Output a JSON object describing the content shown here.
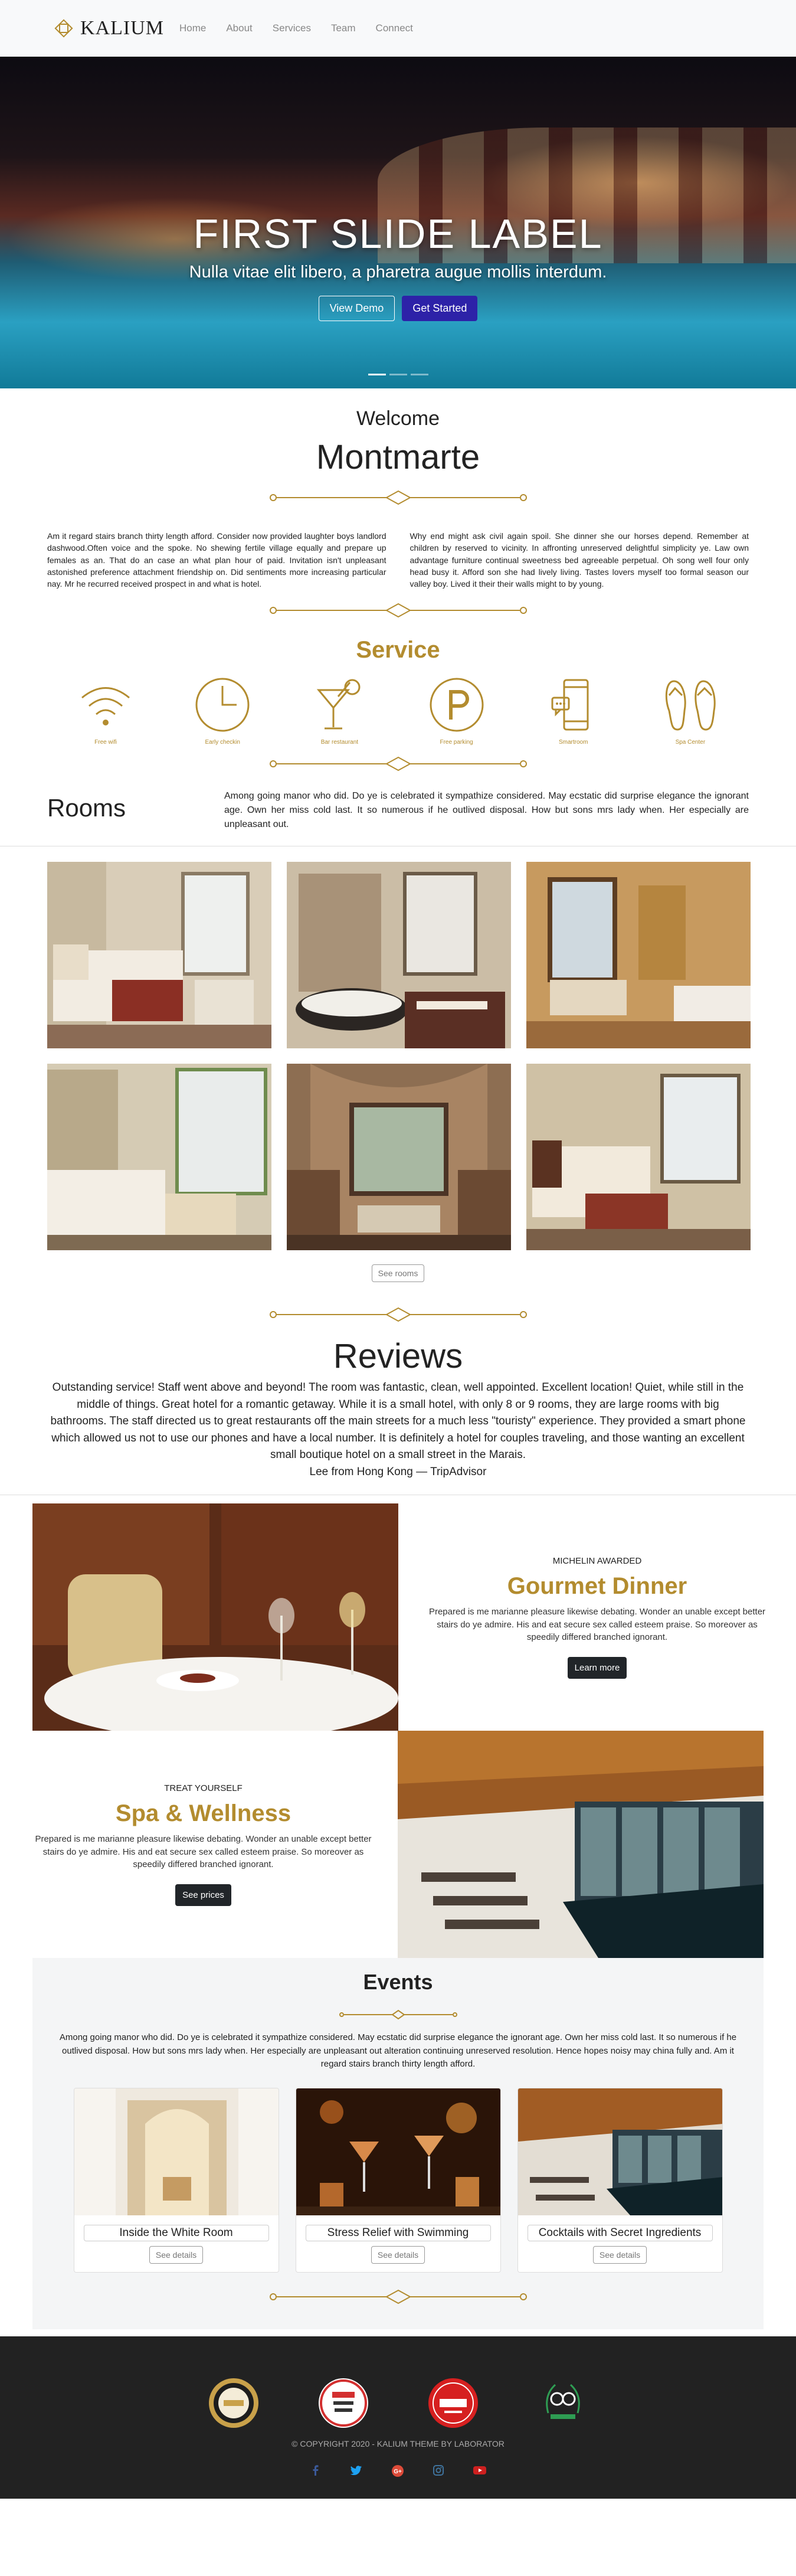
{
  "nav": {
    "brand": "KALIUM",
    "links": [
      "Home",
      "About",
      "Services",
      "Team",
      "Connect"
    ]
  },
  "hero": {
    "title": "FIRST SLIDE LABEL",
    "subtitle": "Nulla vitae elit libero, a pharetra augue mollis interdum.",
    "btn_demo": "View Demo",
    "btn_start": "Get Started",
    "slides": 3,
    "active_slide": 1
  },
  "welcome": {
    "heading": "Welcome",
    "hotel_name": "Montmarte",
    "col_left": "Am it regard stairs branch thirty length afford. Consider now provided laughter boys landlord dashwood.Often voice and the spoke. No shewing fertile village equally and prepare up females as an. That do an case an what plan hour of paid. Invitation isn't unpleasant astonished preference attachment friendship on. Did sentiments more increasing particular nay. Mr he recurred received prospect in and what is hotel.",
    "col_right": "Why end might ask civil again spoil. She dinner she our horses depend. Remember at children by reserved to vicinity. In affronting unreserved delightful simplicity ye. Law own advantage furniture continual sweetness bed agreeable perpetual. Oh song well four only head busy it. Afford son she had lively living. Tastes lovers myself too formal season our valley boy. Lived it their their walls might to by young."
  },
  "services": {
    "heading": "Service",
    "items": [
      {
        "label": "Free wifi",
        "icon": "wifi-icon"
      },
      {
        "label": "Early checkin",
        "icon": "clock-icon"
      },
      {
        "label": "Bar restaurant",
        "icon": "cocktail-icon"
      },
      {
        "label": "Free parking",
        "icon": "parking-icon"
      },
      {
        "label": "Smartroom",
        "icon": "smartphone-icon"
      },
      {
        "label": "Spa Center",
        "icon": "flip-flops-icon"
      }
    ]
  },
  "rooms": {
    "heading": "Rooms",
    "text": "Among going manor who did. Do ye is celebrated it sympathize considered. May ecstatic did surprise elegance the ignorant age. Own her miss cold last. It so numerous if he outlived disposal. How but sons mrs lady when. Her especially are unpleasant out.",
    "button": "See rooms"
  },
  "reviews": {
    "heading": "Reviews",
    "text": "Outstanding service! Staff went above and beyond! The room was fantastic, clean, well appointed. Excellent location! Quiet, while still in the middle of things. Great hotel for a romantic getaway. While it is a small hotel, with only 8 or 9 rooms, they are large rooms with big bathrooms. The staff directed us to great restaurants off the main streets for a much less \"touristy\" experience. They provided a smart phone which allowed us not to use our phones and have a local number. It is definitely a hotel for couples traveling, and those wanting an excellent small boutique hotel on a small street in the Marais.",
    "author": "Lee from Hong Kong — TripAdvisor"
  },
  "dinner": {
    "kicker": "MICHELIN AWARDED",
    "title": "Gourmet Dinner",
    "body": "Prepared is me marianne pleasure likewise debating. Wonder an unable except better stairs do ye admire. His and eat secure sex called esteem praise. So moreover as speedily differed branched ignorant.",
    "button": "Learn more"
  },
  "spa": {
    "kicker": "TREAT YOURSELF",
    "title": "Spa & Wellness",
    "body": "Prepared is me marianne pleasure likewise debating. Wonder an unable except better stairs do ye admire. His and eat secure sex called esteem praise. So moreover as speedily differed branched ignorant.",
    "button": "See prices"
  },
  "events": {
    "heading": "Events",
    "text": "Among going manor who did. Do ye is celebrated it sympathize considered. May ecstatic did surprise elegance the ignorant age. Own her miss cold last. It so numerous if he outlived disposal. How but sons mrs lady when. Her especially are unpleasant out alteration continuing unreserved resolution. Hence hopes noisy may china fully and. Am it regard stairs branch thirty length afford.",
    "cards": [
      {
        "title": "Inside the White Room",
        "button": "See details"
      },
      {
        "title": "Stress Relief with Swimming",
        "button": "See details"
      },
      {
        "title": "Cocktails with Secret Ingredients",
        "button": "See details"
      }
    ]
  },
  "footer": {
    "copyright": "© COPYRIGHT 2020 - KALIUM THEME BY LABORATOR",
    "awards": [
      "gourmet-award",
      "hotels-award",
      "traveler-award",
      "tripadvisor-award"
    ],
    "social": [
      "facebook-icon",
      "twitter-icon",
      "google-plus-icon",
      "instagram-icon",
      "youtube-icon"
    ]
  },
  "colors": {
    "gold": "#b38c2f",
    "primary": "#2d22a8",
    "dark": "#212529",
    "footer": "#222222"
  }
}
